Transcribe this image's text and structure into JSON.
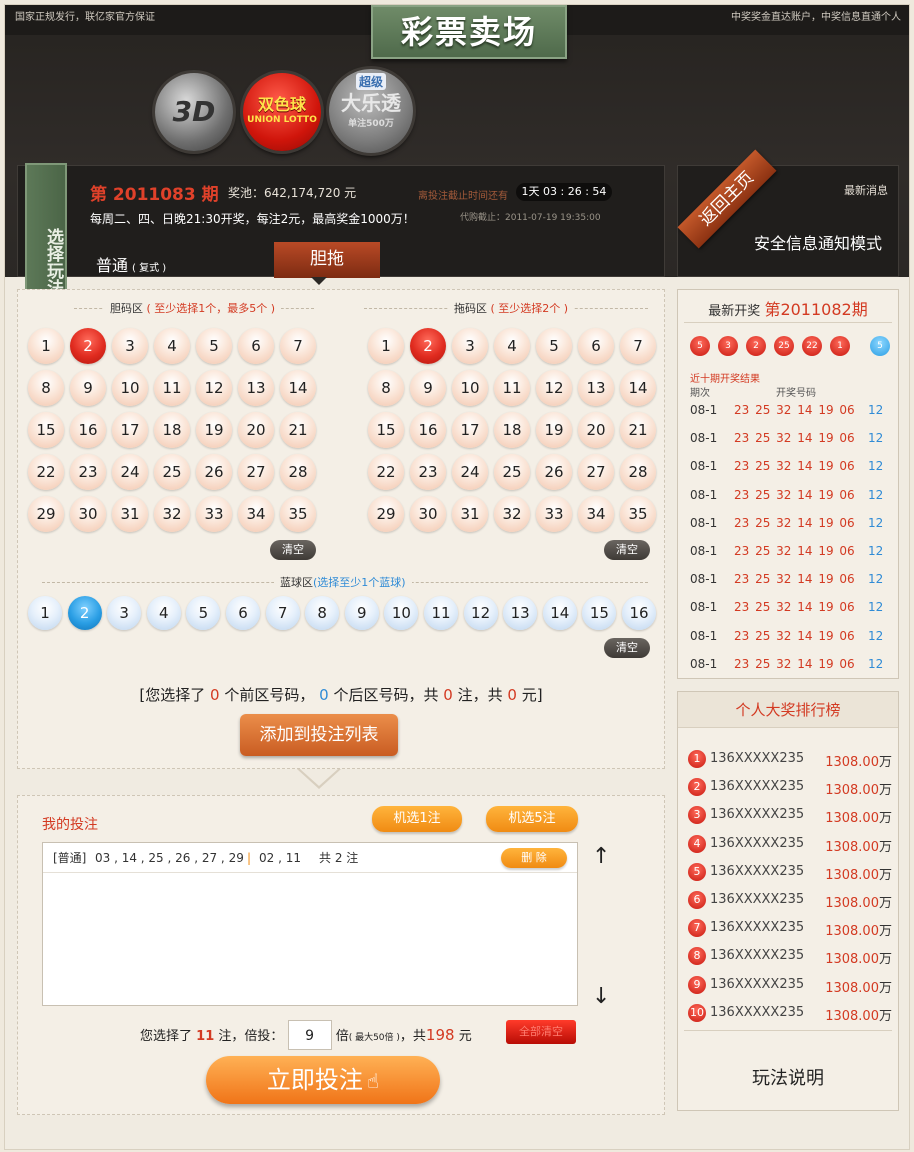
{
  "topbar": {
    "left_text": "国家正规发行，联亿家官方保证",
    "right_text": "中奖奖金直达账户，中奖信息直通个人"
  },
  "page_title": "彩票卖场",
  "logos": [
    {
      "name": "3D",
      "text": "3D"
    },
    {
      "name": "双色球",
      "text": "双色球",
      "sub": "UNION LOTTO"
    },
    {
      "name": "超级大乐透",
      "text": "大乐透",
      "top": "超级",
      "sub": "单注500万"
    }
  ],
  "issue": {
    "label": "第 2011083 期",
    "pool_label": "奖池：642,174,720 元",
    "schedule": "每周二、四、日晚21:30开奖，每注2元，最高奖金1000万！",
    "countdown_label": "离投注截止时间还有",
    "countdown": "1天 03 : 26 : 54",
    "deadline": "代购截止：2011-07-19 19:35:00"
  },
  "ribbon_left": "选择玩法",
  "modes": {
    "normal": "普通",
    "normal_sub": "( 复式 )",
    "dantuo": "胆拖"
  },
  "right_header": {
    "return_home": "返回主页",
    "news_label": "最新消息",
    "news_text": "安全信息通知模式"
  },
  "dan_zone": {
    "title": "胆码区",
    "hint": "( 至少选择1个，最多5个 )",
    "numbers": [
      "1",
      "2",
      "3",
      "4",
      "5",
      "6",
      "7",
      "8",
      "9",
      "10",
      "11",
      "12",
      "13",
      "14",
      "15",
      "16",
      "17",
      "18",
      "19",
      "20",
      "21",
      "22",
      "23",
      "24",
      "25",
      "26",
      "27",
      "28",
      "29",
      "30",
      "31",
      "32",
      "33",
      "34",
      "35"
    ],
    "selected": [
      "2"
    ],
    "clear": "清空"
  },
  "tuo_zone": {
    "title": "拖码区",
    "hint": "( 至少选择2个 )",
    "numbers": [
      "1",
      "2",
      "3",
      "4",
      "5",
      "6",
      "7",
      "8",
      "9",
      "10",
      "11",
      "12",
      "13",
      "14",
      "15",
      "16",
      "17",
      "18",
      "19",
      "20",
      "21",
      "22",
      "23",
      "24",
      "25",
      "26",
      "27",
      "28",
      "29",
      "30",
      "31",
      "32",
      "33",
      "34",
      "35"
    ],
    "selected": [
      "2"
    ],
    "clear": "清空"
  },
  "blue_zone": {
    "title": "蓝球区",
    "hint": "(选择至少1个蓝球)",
    "numbers": [
      "1",
      "2",
      "3",
      "4",
      "5",
      "6",
      "7",
      "8",
      "9",
      "10",
      "11",
      "12",
      "13",
      "14",
      "15",
      "16"
    ],
    "selected": [
      "2"
    ],
    "clear": "清空"
  },
  "summary": {
    "prefix": "[您选择了",
    "front_count": "0",
    "mid1": "个前区号码，",
    "back_count": "0",
    "mid2": "个后区号码，共",
    "bets": "0",
    "mid3": "注，共",
    "amount": "0",
    "suffix": "元]"
  },
  "add_button": "添加到投注列表",
  "my_bets": {
    "title": "我的投注",
    "random1": "机选1注",
    "random5": "机选5注",
    "entry": {
      "type": "[普通]",
      "front": "03 , 14 , 25 , 26 , 27 , 29",
      "sep": "|",
      "back": "02 , 11",
      "count": "共 2 注",
      "delete": "删 除"
    },
    "up_arrow": "↑",
    "down_arrow": "↓",
    "footer": {
      "prefix": "您选择了",
      "bets": "11",
      "mid": "注，倍投：",
      "multiple": "9",
      "unit": "倍",
      "max": "( 最大50倍 )",
      "total_prefix": "，共",
      "total": "198",
      "total_unit": "元",
      "clear_all": "全部清空"
    },
    "submit": "立即投注"
  },
  "latest_draw": {
    "title_prefix": "最新开奖",
    "title_issue": "第2011082期",
    "balls": [
      "5",
      "3",
      "2",
      "25",
      "22",
      "1"
    ],
    "blue": "5",
    "history_title": "近十期开奖结果",
    "col_issue": "期次",
    "col_numbers": "开奖号码",
    "rows": [
      {
        "issue": "08-1",
        "reds": "23 25 32 14 19 06",
        "blue": "12"
      },
      {
        "issue": "08-1",
        "reds": "23 25 32 14 19 06",
        "blue": "12"
      },
      {
        "issue": "08-1",
        "reds": "23 25 32 14 19 06",
        "blue": "12"
      },
      {
        "issue": "08-1",
        "reds": "23 25 32 14 19 06",
        "blue": "12"
      },
      {
        "issue": "08-1",
        "reds": "23 25 32 14 19 06",
        "blue": "12"
      },
      {
        "issue": "08-1",
        "reds": "23 25 32 14 19 06",
        "blue": "12"
      },
      {
        "issue": "08-1",
        "reds": "23 25 32 14 19 06",
        "blue": "12"
      },
      {
        "issue": "08-1",
        "reds": "23 25 32 14 19 06",
        "blue": "12"
      },
      {
        "issue": "08-1",
        "reds": "23 25 32 14 19 06",
        "blue": "12"
      },
      {
        "issue": "08-1",
        "reds": "23 25 32 14 19 06",
        "blue": "12"
      }
    ]
  },
  "ranking": {
    "title": "个人大奖排行榜",
    "rows": [
      {
        "rank": "1",
        "phone": "136XXXXX235",
        "amount": "1308.00",
        "unit": "万"
      },
      {
        "rank": "2",
        "phone": "136XXXXX235",
        "amount": "1308.00",
        "unit": "万"
      },
      {
        "rank": "3",
        "phone": "136XXXXX235",
        "amount": "1308.00",
        "unit": "万"
      },
      {
        "rank": "4",
        "phone": "136XXXXX235",
        "amount": "1308.00",
        "unit": "万"
      },
      {
        "rank": "5",
        "phone": "136XXXXX235",
        "amount": "1308.00",
        "unit": "万"
      },
      {
        "rank": "6",
        "phone": "136XXXXX235",
        "amount": "1308.00",
        "unit": "万"
      },
      {
        "rank": "7",
        "phone": "136XXXXX235",
        "amount": "1308.00",
        "unit": "万"
      },
      {
        "rank": "8",
        "phone": "136XXXXX235",
        "amount": "1308.00",
        "unit": "万"
      },
      {
        "rank": "9",
        "phone": "136XXXXX235",
        "amount": "1308.00",
        "unit": "万"
      },
      {
        "rank": "10",
        "phone": "136XXXXX235",
        "amount": "1308.00",
        "unit": "万"
      }
    ]
  },
  "rules_link": "玩法说明",
  "colors": {
    "accent_red": "#d33a22",
    "accent_blue": "#2f8bd6",
    "header_green": "#5e7a5a",
    "orange": "#f08b13"
  }
}
